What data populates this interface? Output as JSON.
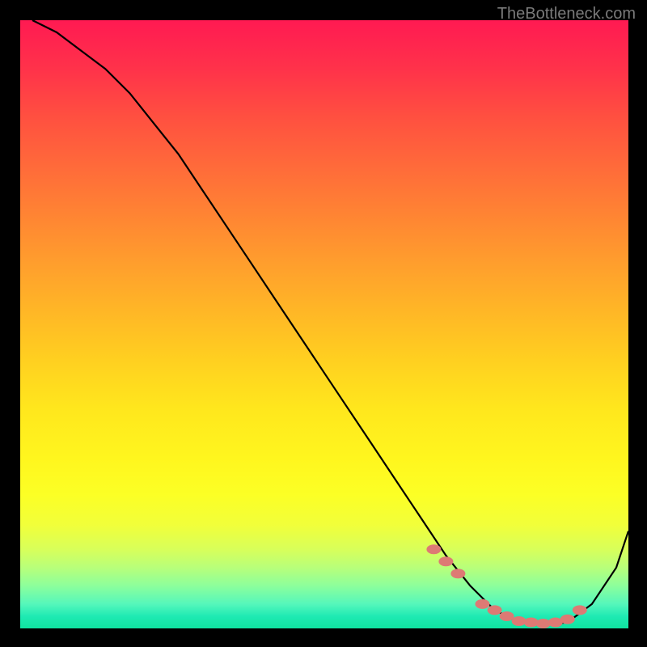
{
  "watermark": "TheBottleneck.com",
  "chart_data": {
    "type": "line",
    "title": "",
    "xlabel": "",
    "ylabel": "",
    "xlim": [
      0,
      100
    ],
    "ylim": [
      0,
      100
    ],
    "series": [
      {
        "name": "bottleneck-curve",
        "x": [
          2,
          6,
          10,
          14,
          18,
          22,
          26,
          30,
          34,
          38,
          42,
          46,
          50,
          54,
          58,
          62,
          66,
          70,
          74,
          78,
          82,
          86,
          90,
          94,
          98,
          100
        ],
        "y": [
          100,
          98,
          95,
          92,
          88,
          83,
          78,
          72,
          66,
          60,
          54,
          48,
          42,
          36,
          30,
          24,
          18,
          12,
          7,
          3,
          1,
          0.5,
          1,
          4,
          10,
          16
        ]
      }
    ],
    "markers": {
      "name": "highlight-points",
      "x": [
        68,
        70,
        72,
        76,
        78,
        80,
        82,
        84,
        86,
        88,
        90,
        92
      ],
      "y": [
        13,
        11,
        9,
        4,
        3,
        2,
        1.2,
        1,
        0.8,
        1,
        1.5,
        3
      ]
    },
    "background_gradient": {
      "top": "#ff1a52",
      "mid": "#ffe71d",
      "bottom": "#0fe3a0"
    },
    "marker_color": "#dd7a74"
  }
}
